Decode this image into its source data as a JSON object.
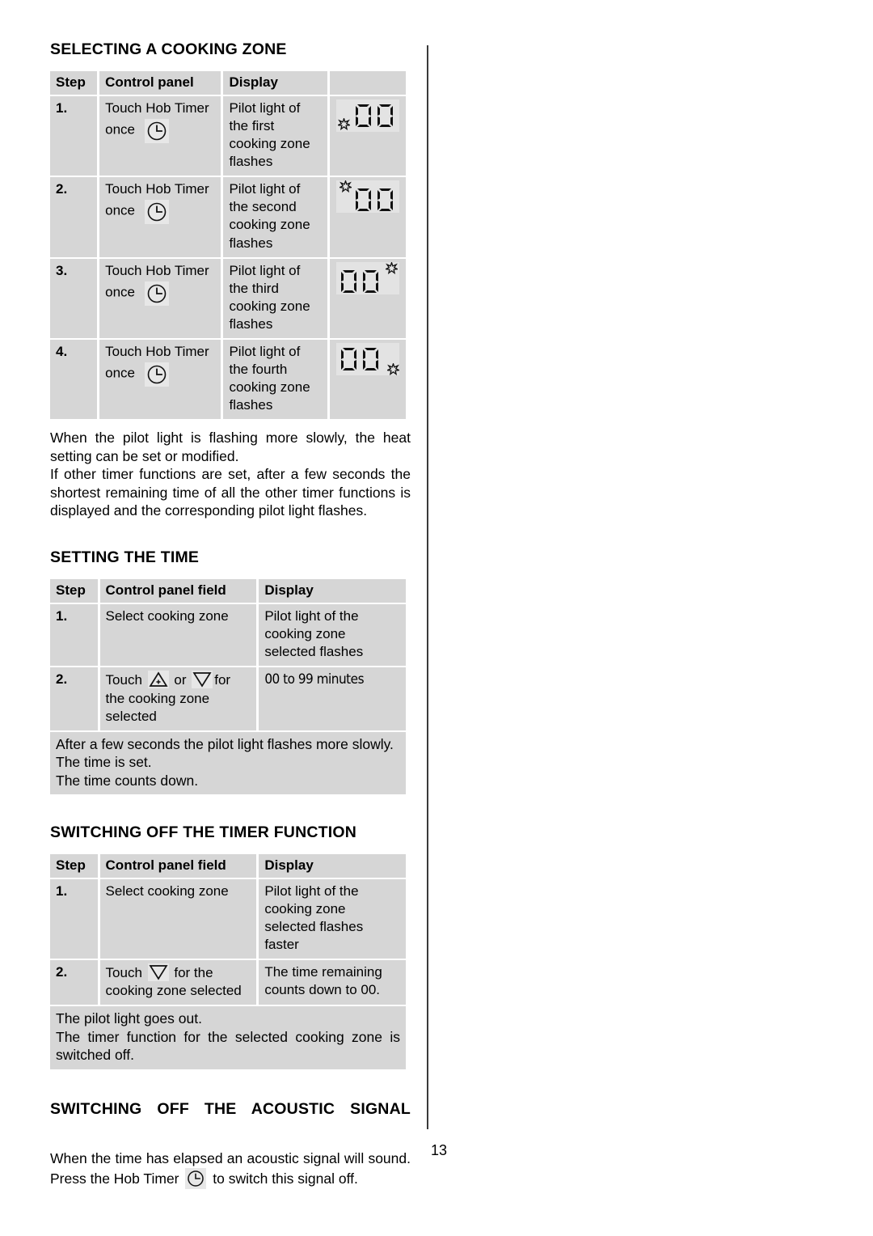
{
  "page": {
    "number": "13"
  },
  "sections": [
    {
      "id": "selecting-a-cooking-zone",
      "title": "SELECTING A COOKING ZONE",
      "table": {
        "headers": [
          "Step",
          "Control panel",
          "Display",
          ""
        ],
        "rows": [
          {
            "step": "1.",
            "control_panel": "Touch Hob Timer once",
            "control_panel_icon": "hob-timer-clock-icon",
            "display": "Pilot light of the first cooking zone flashes",
            "display_graphic": {
              "digits": "00",
              "pilot_star": "bottom-left"
            }
          },
          {
            "step": "2.",
            "control_panel": "Touch Hob Timer once",
            "control_panel_icon": "hob-timer-clock-icon",
            "display": "Pilot light of the second cooking zone flashes",
            "display_graphic": {
              "digits": "00",
              "pilot_star": "top-left"
            }
          },
          {
            "step": "3.",
            "control_panel": "Touch Hob Timer once",
            "control_panel_icon": "hob-timer-clock-icon",
            "display": "Pilot light of the third cooking zone flashes",
            "display_graphic": {
              "digits": "00",
              "pilot_star": "top-right"
            }
          },
          {
            "step": "4.",
            "control_panel": "Touch Hob Timer once",
            "control_panel_icon": "hob-timer-clock-icon",
            "display": "Pilot light of the fourth cooking zone flashes",
            "display_graphic": {
              "digits": "00",
              "pilot_star": "bottom-right"
            }
          }
        ]
      },
      "paragraphs": [
        "When the pilot light is flashing more slowly, the heat setting can be set or modified.",
        "If other timer functions are set, after a few seconds the shortest remaining time of all the other timer functions is displayed and the corresponding pilot light flashes."
      ]
    },
    {
      "id": "setting-the-time",
      "title": "SETTING THE TIME",
      "table": {
        "headers": [
          "Step",
          "Control panel field",
          "Display"
        ],
        "rows": [
          {
            "step": "1.",
            "control_panel": "Select cooking zone",
            "display": "Pilot light of the cooking zone selected flashes"
          },
          {
            "step": "2.",
            "control_panel_pre": "Touch",
            "control_panel_mid": "or",
            "control_panel_post": "for the cooking zone selected",
            "icon_up": "increase-triangle-icon",
            "icon_down": "decrease-triangle-icon",
            "display": "00 to 99 minutes"
          }
        ],
        "note": [
          "After a few seconds the pilot light flashes more slowly.",
          "The time is set.",
          "The time counts down."
        ]
      }
    },
    {
      "id": "switching-off-the-timer-function",
      "title": "SWITCHING OFF THE TIMER FUNCTION",
      "table": {
        "headers": [
          "Step",
          "Control panel field",
          "Display"
        ],
        "rows": [
          {
            "step": "1.",
            "control_panel": "Select cooking zone",
            "display": "Pilot light of the cooking zone selected flashes faster"
          },
          {
            "step": "2.",
            "control_panel_pre": "Touch",
            "control_panel_post": "for the cooking zone selected",
            "icon_down": "decrease-triangle-icon",
            "display": "The time remaining counts down to 00."
          }
        ],
        "note": [
          "The pilot light goes out.",
          "The timer function for the selected cooking zone is switched off."
        ]
      }
    },
    {
      "id": "switching-off-the-acoustic-signal",
      "title": "SWITCHING OFF THE ACOUSTIC SIGNAL",
      "paragraph_pre": "When the time has elapsed an acoustic signal will sound.  Press the Hob Timer",
      "paragraph_icon": "hob-timer-clock-icon",
      "paragraph_post": "to switch this signal off."
    }
  ],
  "colors": {
    "cell_background": "#d6d6d6",
    "icon_background": "#e7e7e7",
    "rule": "#3a3a3a",
    "text": "#000000"
  }
}
